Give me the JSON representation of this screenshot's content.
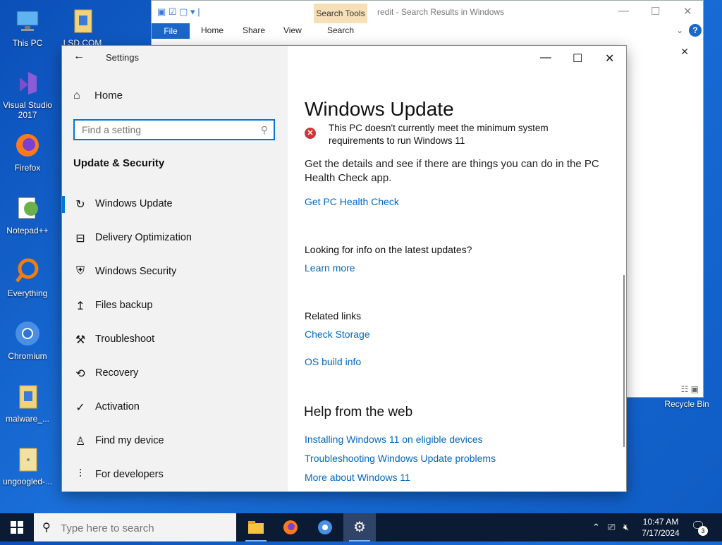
{
  "desktop": {
    "icons": [
      {
        "label": "This PC",
        "icon": "pc-icon"
      },
      {
        "label": "LSD.COM",
        "icon": "folder-icon"
      },
      {
        "label": "Visual Studio 2017",
        "icon": "visual-studio-icon"
      },
      {
        "label": "Firefox",
        "icon": "firefox-icon"
      },
      {
        "label": "Notepad++",
        "icon": "notepad-plus-plus-icon"
      },
      {
        "label": "Everything",
        "icon": "everything-icon"
      },
      {
        "label": "Chromium",
        "icon": "chromium-icon"
      },
      {
        "label": "malware_...",
        "icon": "file-icon"
      },
      {
        "label": "ungoogled-...",
        "icon": "file-icon"
      },
      {
        "label": "Recycle Bin",
        "icon": "recycle-bin-icon"
      }
    ]
  },
  "explorer": {
    "title": "redit - Search Results in Windows",
    "context_tab": "Search Tools",
    "ribbon": {
      "file": "File",
      "home": "Home",
      "share": "Share",
      "view": "View",
      "search": "Search"
    }
  },
  "settings": {
    "app_title": "Settings",
    "home": "Home",
    "search_placeholder": "Find a setting",
    "section": "Update & Security",
    "nav": [
      {
        "label": "Windows Update",
        "icon": "refresh-icon"
      },
      {
        "label": "Delivery Optimization",
        "icon": "delivery-optimization-icon"
      },
      {
        "label": "Windows Security",
        "icon": "shield-icon"
      },
      {
        "label": "Files backup",
        "icon": "backup-icon"
      },
      {
        "label": "Troubleshoot",
        "icon": "wrench-icon"
      },
      {
        "label": "Recovery",
        "icon": "recovery-icon"
      },
      {
        "label": "Activation",
        "icon": "check-circle-icon"
      },
      {
        "label": "Find my device",
        "icon": "find-device-icon"
      },
      {
        "label": "For developers",
        "icon": "developer-icon"
      }
    ],
    "content": {
      "title": "Windows Update",
      "error": "This PC doesn't currently meet the minimum system requirements to run Windows 11",
      "details": "Get the details and see if there are things you can do in the PC Health Check app.",
      "health_check_link": "Get PC Health Check",
      "info_question": "Looking for info on the latest updates?",
      "learn_more": "Learn more",
      "related_links": "Related links",
      "check_storage": "Check Storage",
      "os_build_info": "OS build info",
      "help_heading": "Help from the web",
      "help_links": [
        "Installing Windows 11 on eligible devices",
        "Troubleshooting Windows Update problems",
        "More about Windows 11"
      ]
    }
  },
  "taskbar": {
    "search_placeholder": "Type here to search",
    "apps": [
      "file-explorer-icon",
      "firefox-icon",
      "chromium-icon",
      "settings-gear-icon"
    ],
    "time": "10:47 AM",
    "date": "7/17/2024",
    "notifications": "3"
  },
  "colors": {
    "accent": "#0078d7",
    "link": "#0067c0",
    "error": "#d13438"
  }
}
